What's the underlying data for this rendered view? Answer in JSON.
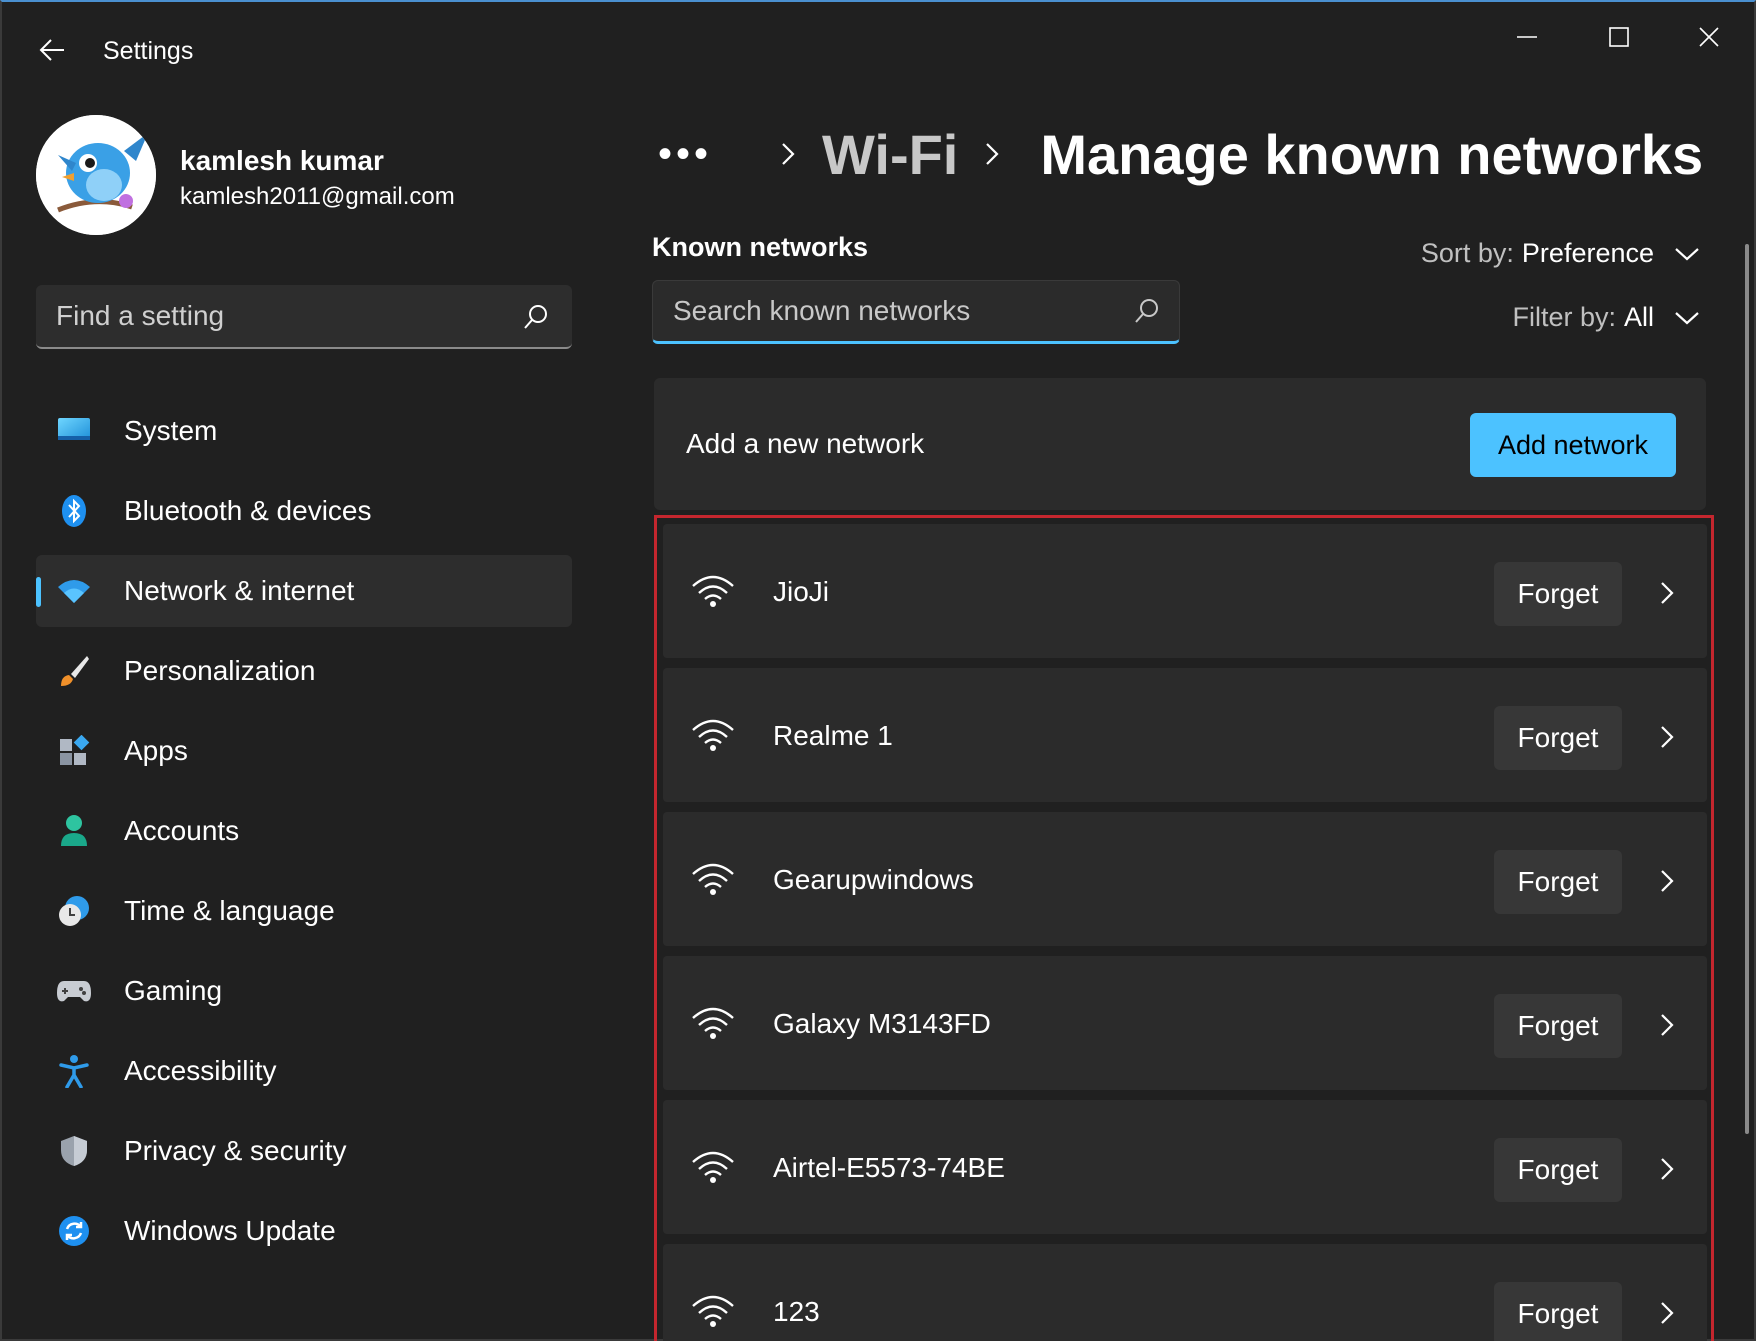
{
  "window": {
    "title": "Settings"
  },
  "profile": {
    "name": "kamlesh kumar",
    "email": "kamlesh2011@gmail.com"
  },
  "sidebar": {
    "search_placeholder": "Find a setting",
    "items": [
      {
        "label": "System",
        "icon": "monitor-icon",
        "active": false
      },
      {
        "label": "Bluetooth & devices",
        "icon": "bluetooth-icon",
        "active": false
      },
      {
        "label": "Network & internet",
        "icon": "wifi-icon",
        "active": true
      },
      {
        "label": "Personalization",
        "icon": "brush-icon",
        "active": false
      },
      {
        "label": "Apps",
        "icon": "apps-icon",
        "active": false
      },
      {
        "label": "Accounts",
        "icon": "person-icon",
        "active": false
      },
      {
        "label": "Time & language",
        "icon": "clock-globe-icon",
        "active": false
      },
      {
        "label": "Gaming",
        "icon": "gamepad-icon",
        "active": false
      },
      {
        "label": "Accessibility",
        "icon": "accessibility-icon",
        "active": false
      },
      {
        "label": "Privacy & security",
        "icon": "shield-icon",
        "active": false
      },
      {
        "label": "Windows Update",
        "icon": "update-icon",
        "active": false
      }
    ]
  },
  "breadcrumb": {
    "more": "•••",
    "parent": "Wi-Fi",
    "current": "Manage known networks"
  },
  "main": {
    "section_title": "Known networks",
    "search_placeholder": "Search known networks",
    "sort": {
      "label": "Sort by:",
      "value": "Preference"
    },
    "filter": {
      "label": "Filter by:",
      "value": "All"
    },
    "add_card": {
      "label": "Add a new network",
      "button": "Add network"
    },
    "forget_label": "Forget",
    "networks": [
      {
        "name": "JioJi"
      },
      {
        "name": "Realme 1"
      },
      {
        "name": "Gearupwindows"
      },
      {
        "name": "Galaxy M3143FD"
      },
      {
        "name": "Airtel-E5573-74BE"
      },
      {
        "name": "123"
      }
    ]
  },
  "colors": {
    "accent": "#4cc2ff",
    "highlight_frame": "#c4262e",
    "background": "#202020",
    "card": "#2b2b2b"
  }
}
